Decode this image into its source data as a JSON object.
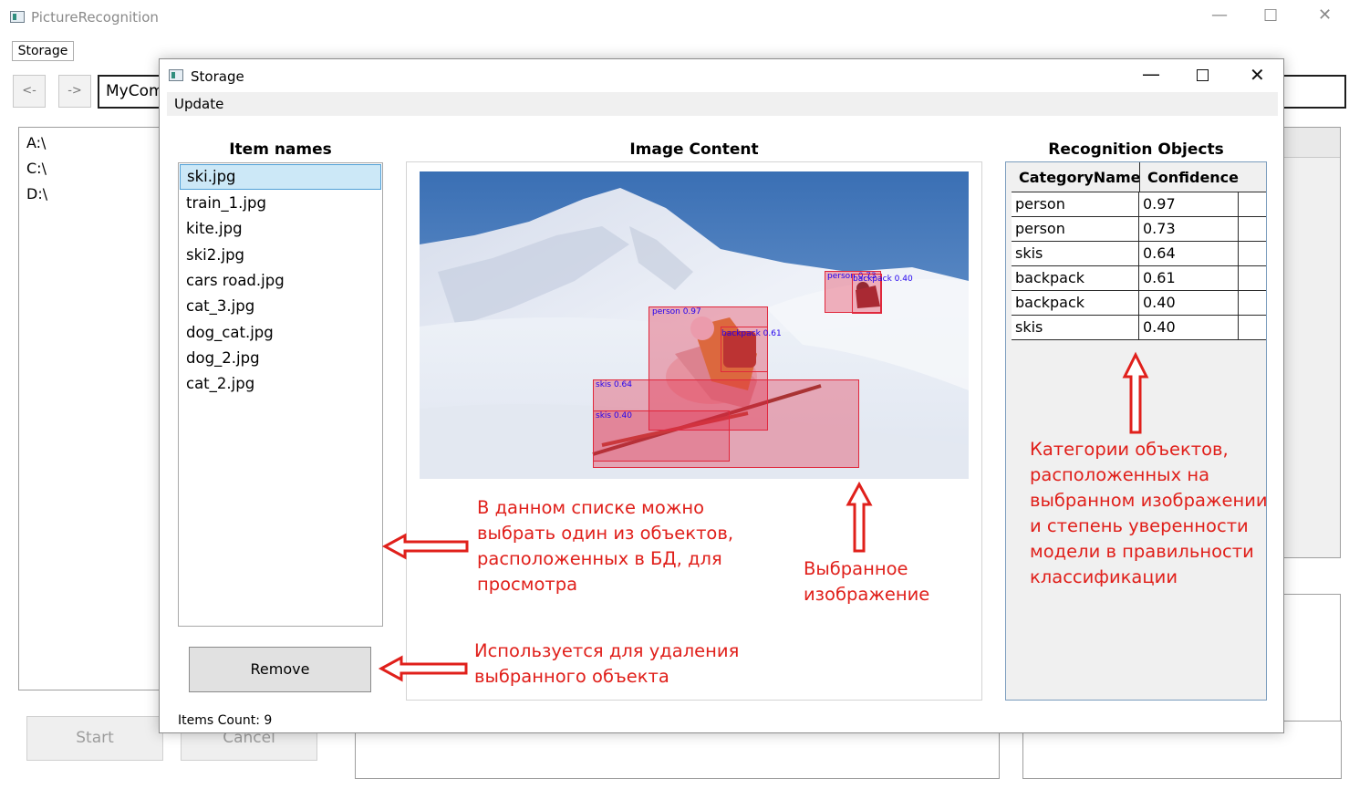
{
  "main_window": {
    "title": "PictureRecognition",
    "menu_storage": "Storage",
    "back_label": "<-",
    "forward_label": "->",
    "path_value": "MyCom",
    "drives": [
      "A:\\",
      "C:\\",
      "D:\\"
    ],
    "start_label": "Start",
    "cancel_label": "Cancel"
  },
  "dialog": {
    "title": "Storage",
    "menu_update": "Update",
    "items_heading": "Item names",
    "items": [
      "ski.jpg",
      "train_1.jpg",
      "kite.jpg",
      "ski2.jpg",
      "cars road.jpg",
      "cat_3.jpg",
      "dog_cat.jpg",
      "dog_2.jpg",
      "cat_2.jpg"
    ],
    "selected_item": "ski.jpg",
    "remove_label": "Remove",
    "items_count": "Items Count: 9",
    "image_heading": "Image Content",
    "recognition_heading": "Recognition Objects",
    "columns": [
      "CategoryName",
      "Confidence"
    ],
    "objects": [
      {
        "category": "person",
        "confidence": "0.97"
      },
      {
        "category": "person",
        "confidence": "0.73"
      },
      {
        "category": "skis",
        "confidence": "0.64"
      },
      {
        "category": "backpack",
        "confidence": "0.61"
      },
      {
        "category": "backpack",
        "confidence": "0.40"
      },
      {
        "category": "skis",
        "confidence": "0.40"
      }
    ],
    "box_labels": {
      "person_main": "person 0.97",
      "person_far": "person 0.73",
      "backpack_main": "backpack 0.61",
      "backpack_far": "backpack 0.40",
      "skis_a": "skis 0.64",
      "skis_b": "skis 0.40"
    }
  },
  "annotations": {
    "list_note": [
      "В данном списке можно",
      "выбрать один из объектов,",
      "расположенных в БД, для",
      "просмотра"
    ],
    "image_note": [
      "Выбранное",
      "изображение"
    ],
    "objects_note": [
      "Категории объектов,",
      "расположенных на",
      "выбранном изображении",
      "и степень уверенности",
      "модели в правильности",
      "классификации"
    ],
    "remove_note": [
      "Используется для удаления",
      "выбранного объекта"
    ]
  },
  "colors": {
    "annotation": "#e0201b",
    "selection": "#cce8f7",
    "box_fill": "rgba(225,40,70,0.35)",
    "box_label": "#2200ee"
  }
}
